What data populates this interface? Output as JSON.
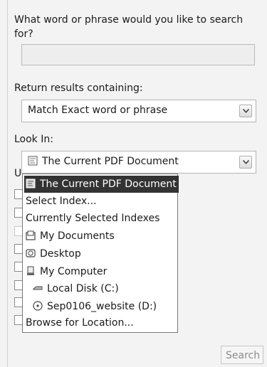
{
  "search": {
    "question": "What word or phrase would you like to search for?",
    "value": ""
  },
  "results": {
    "label": "Return results containing:",
    "selected": "Match Exact word or phrase"
  },
  "look_in": {
    "label": "Look In:",
    "selected": "The Current PDF Document",
    "options": [
      {
        "label": "The Current PDF Document",
        "icon": "pdf-document-icon"
      },
      {
        "label": "Select Index...",
        "icon": ""
      },
      {
        "label": "Currently Selected Indexes",
        "icon": ""
      },
      {
        "label": "My Documents",
        "icon": "folder-documents-icon"
      },
      {
        "label": "Desktop",
        "icon": "desktop-icon"
      },
      {
        "label": "My Computer",
        "icon": "computer-icon"
      },
      {
        "label": "Local Disk (C:)",
        "icon": "hard-disk-icon"
      },
      {
        "label": "Sep0106_website (D:)",
        "icon": "optical-drive-icon"
      },
      {
        "label": "Browse for Location...",
        "icon": ""
      }
    ]
  },
  "hidden_section_initial": "U",
  "search_button": "Search"
}
